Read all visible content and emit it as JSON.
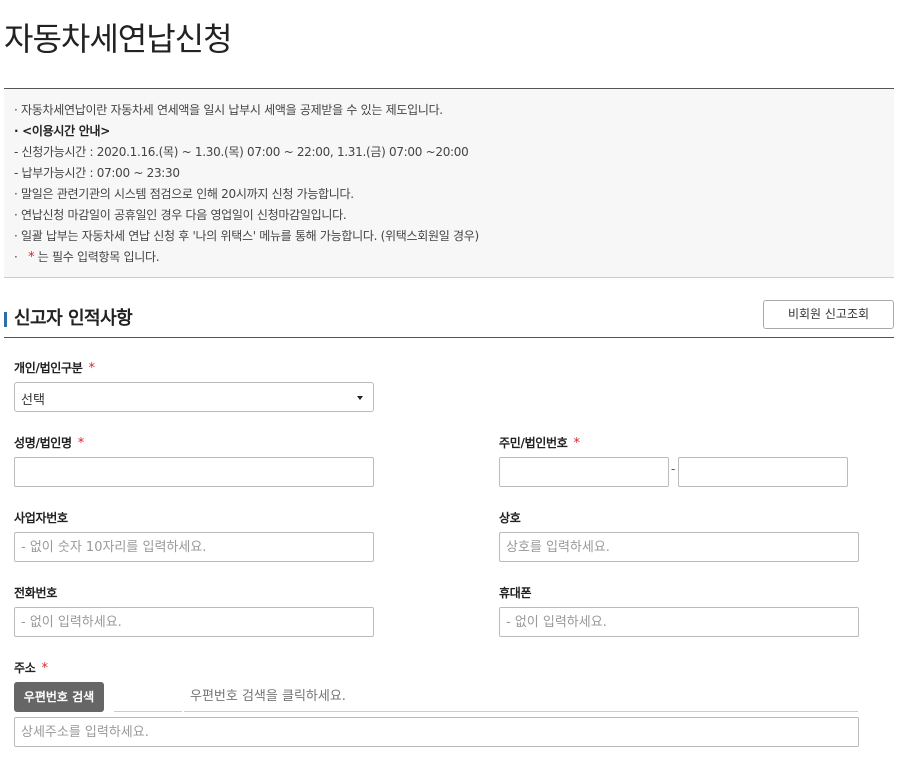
{
  "page": {
    "title": "자동차세연납신청"
  },
  "notice": {
    "lines": [
      "· 자동차세연납이란 자동차세 연세액을 일시 납부시 세액을 공제받을 수 있는 제도입니다.",
      "· <이용시간 안내>",
      "  - 신청가능시간 : 2020.1.16.(목) ~ 1.30.(목) 07:00 ~ 22:00, 1.31.(금) 07:00 ~20:00",
      "  - 납부가능시간 : 07:00 ~ 23:30",
      "· 말일은 관련기관의 시스템 점검으로 인해 20시까지 신청 가능합니다.",
      "· 연납신청 마감일이 공휴일인 경우 다음 영업일이 신청마감일입니다.",
      "· 일괄 납부는 자동차세 연납 신청 후 '나의 위택스' 메뉴를 통해 가능합니다. (위택스회원일 경우)"
    ],
    "required_prefix": "·",
    "required_star": "*",
    "required_text": "는 필수 입력항목 입니다."
  },
  "section": {
    "title": "신고자 인적사항",
    "lookup_button": "비회원 신고조회"
  },
  "form": {
    "required_star": "*",
    "type": {
      "label": "개인/법인구분",
      "selected": "선택"
    },
    "name": {
      "label": "성명/법인명",
      "value": ""
    },
    "id_number": {
      "label": "주민/법인번호",
      "separator": "-"
    },
    "business_number": {
      "label": "사업자번호",
      "placeholder": "- 없이 숫자 10자리를 입력하세요."
    },
    "company": {
      "label": "상호",
      "placeholder": "상호를 입력하세요."
    },
    "phone": {
      "label": "전화번호",
      "placeholder": "- 없이 입력하세요."
    },
    "mobile": {
      "label": "휴대폰",
      "placeholder": "- 없이 입력하세요."
    },
    "address": {
      "label": "주소",
      "zip_button": "우편번호 검색",
      "zip_placeholder": "우편번호 검색을 클릭하세요.",
      "detail_placeholder": "상세주소를 입력하세요."
    }
  }
}
